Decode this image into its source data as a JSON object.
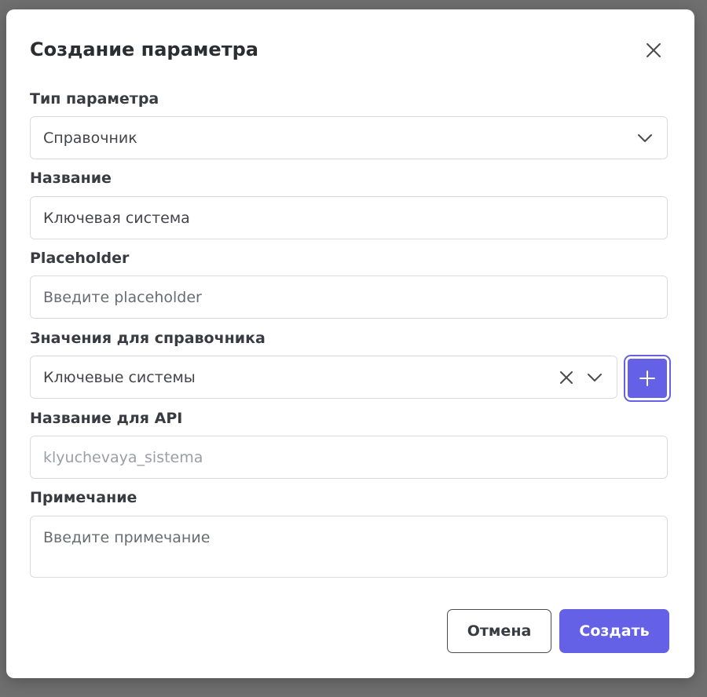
{
  "dialog": {
    "title": "Создание параметра"
  },
  "fields": {
    "param_type": {
      "label": "Тип параметра",
      "value": "Справочник"
    },
    "name": {
      "label": "Название",
      "value": "Ключевая система"
    },
    "placeholder": {
      "label": "Placeholder",
      "placeholder": "Введите placeholder"
    },
    "dictionary_values": {
      "label": "Значения для справочника",
      "value": "Ключевые системы"
    },
    "api_name": {
      "label": "Название для API",
      "value": "klyuchevaya_sistema"
    },
    "note": {
      "label": "Примечание",
      "placeholder": "Введите примечание"
    }
  },
  "actions": {
    "cancel_label": "Отмена",
    "create_label": "Создать"
  },
  "icons": {
    "close": "close-icon",
    "chevron": "chevron-down-icon",
    "clear": "clear-icon",
    "plus": "plus-icon"
  },
  "colors": {
    "accent": "#6561e6",
    "border": "#d9dbe0",
    "text": "#2c2d33"
  }
}
